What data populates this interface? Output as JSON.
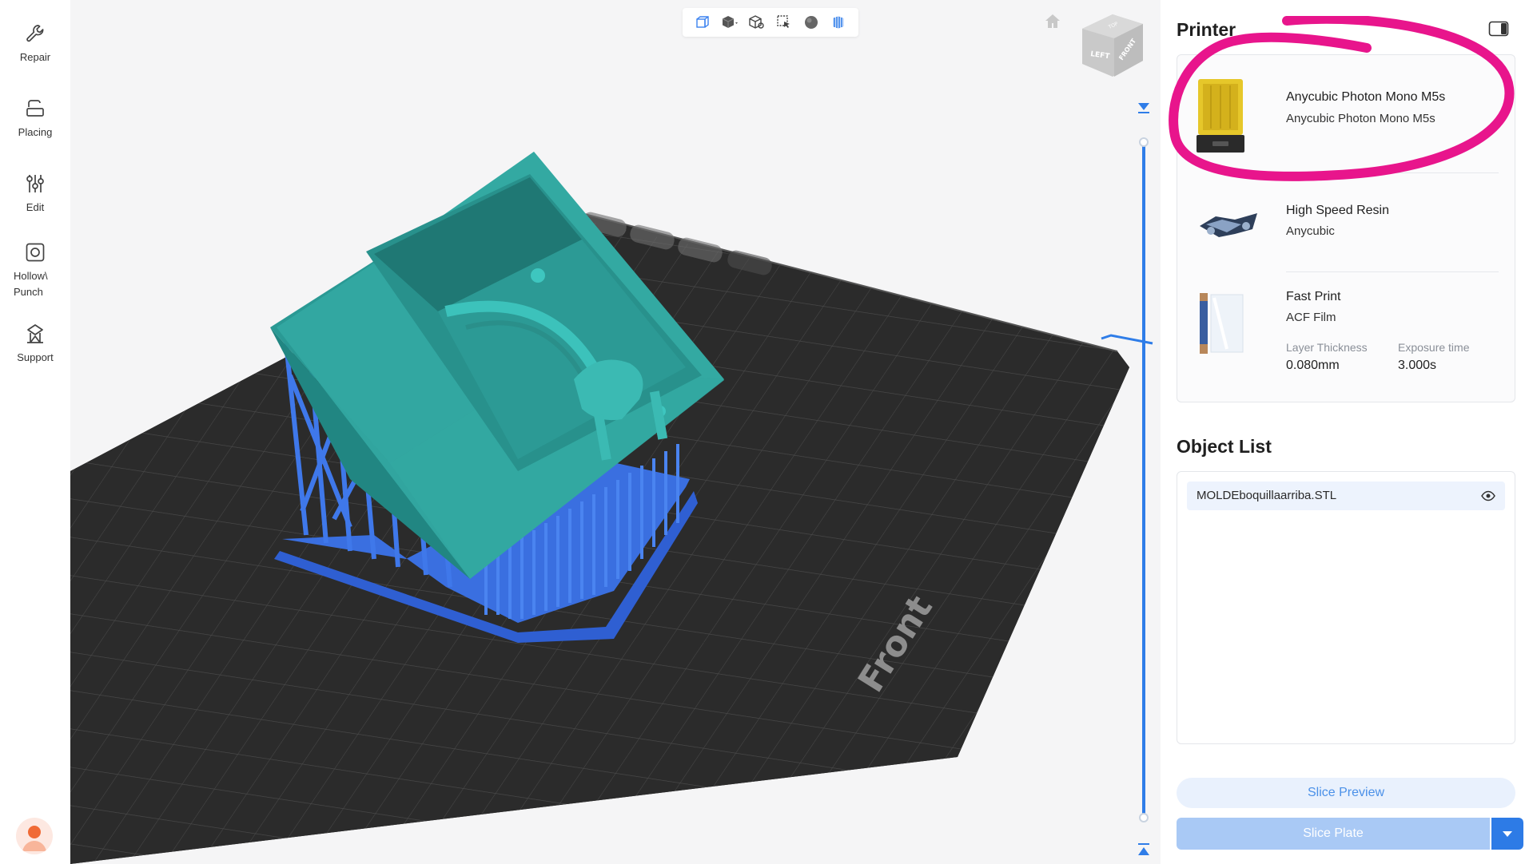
{
  "left_toolbar": {
    "tools": [
      {
        "id": "repair",
        "label": "Repair",
        "icon": "wrench-icon"
      },
      {
        "id": "placing",
        "label": "Placing",
        "icon": "placing-icon"
      },
      {
        "id": "edit",
        "label": "Edit",
        "icon": "sliders-icon"
      },
      {
        "id": "hollow",
        "label": "Hollow\\\nPunch",
        "icon": "hollow-icon"
      },
      {
        "id": "support",
        "label": "Support",
        "icon": "support-icon"
      }
    ]
  },
  "viewport": {
    "bed_label": "Front",
    "view_cube_labels": {
      "left": "LEFT",
      "front": "FRONT",
      "top": "TOP"
    },
    "view_tools": [
      "perspective-icon",
      "cube-shaded-icon",
      "cube-outline-icon",
      "select-icon",
      "sphere-icon",
      "slice-view-icon"
    ]
  },
  "right_panel": {
    "printer_title": "Printer",
    "printer": {
      "name": "Anycubic Photon Mono M5s",
      "model": "Anycubic Photon Mono M5s"
    },
    "resin": {
      "name": "High Speed Resin",
      "brand": "Anycubic"
    },
    "profile": {
      "name": "Fast Print",
      "film": "ACF Film",
      "layer_thickness_label": "Layer Thickness",
      "layer_thickness": "0.080mm",
      "exposure_label": "Exposure time",
      "exposure": "3.000s"
    },
    "object_list_title": "Object List",
    "objects": [
      {
        "name": "MOLDEboquillaarriba.STL"
      }
    ],
    "slice_preview_label": "Slice Preview",
    "slice_plate_label": "Slice Plate"
  },
  "colors": {
    "accent": "#2d7be6",
    "model": "#2ea5a0",
    "supports": "#3a6fe0",
    "bed": "#2b2b2b",
    "highlight": "#e8158c"
  }
}
